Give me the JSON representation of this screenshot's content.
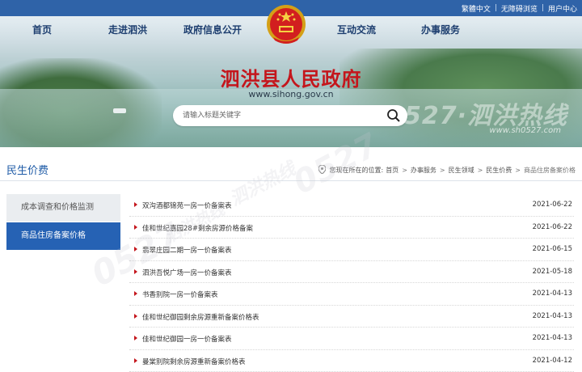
{
  "top_links": [
    "繁體中文",
    "无障碍浏览",
    "用户中心"
  ],
  "nav": {
    "home": "首页",
    "about": "走进泗洪",
    "info": "政府信息公开",
    "interact": "互动交流",
    "service": "办事服务"
  },
  "site": {
    "title": "泗洪县人民政府",
    "url": "www.sihong.gov.cn"
  },
  "search": {
    "placeholder": "请输入标题关键字"
  },
  "watermark": {
    "big": "0527 泗洪热线",
    "small": "www.sh0527.com"
  },
  "section": {
    "title": "民生价费"
  },
  "breadcrumb": {
    "prefix": "您现在所在的位置:",
    "items": [
      "首页",
      "办事服务",
      "民生领域",
      "民生价费"
    ],
    "current": "商品住房备案价格"
  },
  "sidebar": {
    "items": [
      {
        "label": "成本调查和价格监测",
        "active": false
      },
      {
        "label": "商品住房备案价格",
        "active": true
      }
    ]
  },
  "articles": [
    {
      "title": "双沟酒都锦苑一房一价备案表",
      "date": "2021-06-22"
    },
    {
      "title": "佳和世纪嘉园28#剩余房源价格备案",
      "date": "2021-06-22"
    },
    {
      "title": "翡翠庄园二期一房一价备案表",
      "date": "2021-06-15"
    },
    {
      "title": "泗洪吾悦广场一房一价备案表",
      "date": "2021-05-18"
    },
    {
      "title": "书香别院一房一价备案表",
      "date": "2021-04-13"
    },
    {
      "title": "佳和世纪御园剩余房源重新备案价格表",
      "date": "2021-04-13"
    },
    {
      "title": "佳和世纪御园一房一价备案表",
      "date": "2021-04-13"
    },
    {
      "title": "曼棠别院剩余房源重新备案价格表",
      "date": "2021-04-12"
    }
  ],
  "colors": {
    "brand_blue": "#2662b4",
    "title_red": "#c4161c",
    "nav_text": "#1d3e6f"
  }
}
